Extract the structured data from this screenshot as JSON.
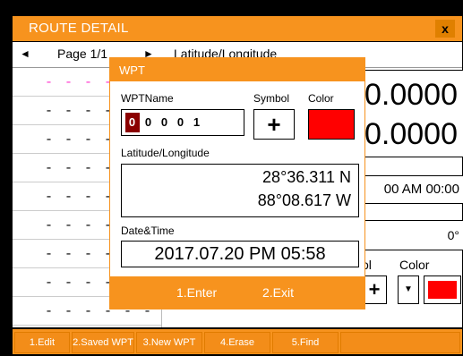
{
  "window": {
    "title": "ROUTE DETAIL",
    "close_label": "x"
  },
  "pager": {
    "prev_icon": "left-arrow",
    "page_label": "Page 1/1",
    "next_icon": "right-arrow",
    "column_label": "Latitude/Longitude"
  },
  "waypoint_list": [
    {
      "text": "- - - - - -",
      "highlight": true
    },
    {
      "text": "- - - - - -",
      "highlight": false
    },
    {
      "text": "- - - - - -",
      "highlight": false
    },
    {
      "text": "- - - - - -",
      "highlight": false
    },
    {
      "text": "- - - - - -",
      "highlight": false
    },
    {
      "text": "- - - - - -",
      "highlight": false
    },
    {
      "text": "- - - - - -",
      "highlight": false
    },
    {
      "text": "- - - - - -",
      "highlight": false
    },
    {
      "text": "- - - - - -",
      "highlight": false
    }
  ],
  "background_panel": {
    "big_value_1": "0.0000",
    "big_value_2": "0.0000",
    "time_value": "00 AM 00:00",
    "degree_value": "0°",
    "symbol_label": "ol",
    "color_label": "Color",
    "symbol_glyph": "+",
    "dropdown_glyph": "▼",
    "color_hex": "#ff0000"
  },
  "dialog": {
    "title": "WPT",
    "name_label": "WPTName",
    "symbol_label": "Symbol",
    "color_label": "Color",
    "name_digits": [
      "0",
      "0",
      "0",
      "0",
      "1"
    ],
    "symbol_glyph": "+",
    "color_hex": "#ff0000",
    "latlon_label": "Latitude/Longitude",
    "latitude": "28°36.311 N",
    "longitude": "88°08.617 W",
    "datetime_label": "Date&Time",
    "datetime_value": "2017.07.20 PM 05:58",
    "enter_label": "1.Enter",
    "exit_label": "2.Exit"
  },
  "status_buttons": [
    {
      "label": "1.Edit"
    },
    {
      "label": "2.Saved WPT"
    },
    {
      "label": "3.New WPT"
    },
    {
      "label": "4.Erase"
    },
    {
      "label": "5.Find"
    },
    {
      "label": ""
    }
  ],
  "colors": {
    "accent": "#f7931e",
    "selected_digit_bg": "#8b0000",
    "route_highlight": "#ff33cc"
  }
}
